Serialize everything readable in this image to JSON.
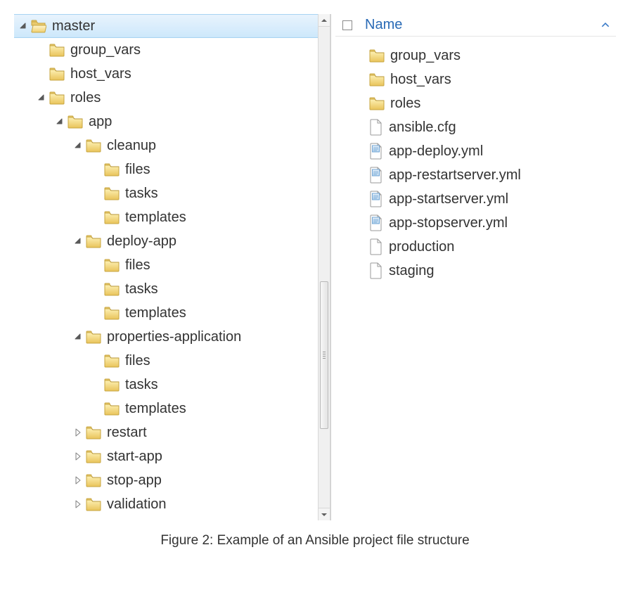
{
  "tree": [
    {
      "depth": 0,
      "exp": "open",
      "icon": "folder-open",
      "label": "master",
      "selected": true
    },
    {
      "depth": 1,
      "exp": "none",
      "icon": "folder",
      "label": "group_vars"
    },
    {
      "depth": 1,
      "exp": "none",
      "icon": "folder",
      "label": "host_vars"
    },
    {
      "depth": 1,
      "exp": "open",
      "icon": "folder",
      "label": "roles"
    },
    {
      "depth": 2,
      "exp": "open",
      "icon": "folder",
      "label": "app"
    },
    {
      "depth": 3,
      "exp": "open",
      "icon": "folder",
      "label": "cleanup"
    },
    {
      "depth": 4,
      "exp": "none",
      "icon": "folder",
      "label": "files"
    },
    {
      "depth": 4,
      "exp": "none",
      "icon": "folder",
      "label": "tasks"
    },
    {
      "depth": 4,
      "exp": "none",
      "icon": "folder",
      "label": "templates"
    },
    {
      "depth": 3,
      "exp": "open",
      "icon": "folder",
      "label": "deploy-app"
    },
    {
      "depth": 4,
      "exp": "none",
      "icon": "folder",
      "label": "files"
    },
    {
      "depth": 4,
      "exp": "none",
      "icon": "folder",
      "label": "tasks"
    },
    {
      "depth": 4,
      "exp": "none",
      "icon": "folder",
      "label": "templates"
    },
    {
      "depth": 3,
      "exp": "open",
      "icon": "folder",
      "label": "properties-application"
    },
    {
      "depth": 4,
      "exp": "none",
      "icon": "folder",
      "label": "files"
    },
    {
      "depth": 4,
      "exp": "none",
      "icon": "folder",
      "label": "tasks"
    },
    {
      "depth": 4,
      "exp": "none",
      "icon": "folder",
      "label": "templates"
    },
    {
      "depth": 3,
      "exp": "closed",
      "icon": "folder",
      "label": "restart"
    },
    {
      "depth": 3,
      "exp": "closed",
      "icon": "folder",
      "label": "start-app"
    },
    {
      "depth": 3,
      "exp": "closed",
      "icon": "folder",
      "label": "stop-app"
    },
    {
      "depth": 3,
      "exp": "closed",
      "icon": "folder",
      "label": "validation"
    }
  ],
  "detailHeader": {
    "name": "Name"
  },
  "details": [
    {
      "icon": "folder",
      "label": "group_vars"
    },
    {
      "icon": "folder",
      "label": "host_vars"
    },
    {
      "icon": "folder",
      "label": "roles"
    },
    {
      "icon": "file",
      "label": "ansible.cfg"
    },
    {
      "icon": "doc",
      "label": "app-deploy.yml"
    },
    {
      "icon": "doc",
      "label": "app-restartserver.yml"
    },
    {
      "icon": "doc",
      "label": "app-startserver.yml"
    },
    {
      "icon": "doc",
      "label": "app-stopserver.yml"
    },
    {
      "icon": "file",
      "label": "production"
    },
    {
      "icon": "file",
      "label": "staging"
    }
  ],
  "caption": "Figure 2: Example of an Ansible project file structure"
}
